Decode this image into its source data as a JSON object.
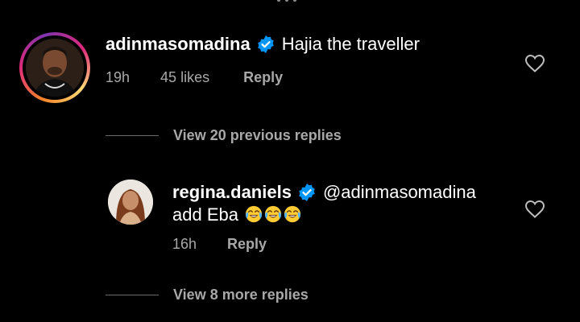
{
  "comments": [
    {
      "username": "adinmasomadina",
      "text": "Hajia the traveller",
      "time": "19h",
      "likes": "45 likes",
      "reply_label": "Reply",
      "verified": true,
      "has_story_ring": true
    }
  ],
  "view_previous": "View 20 previous replies",
  "reply": {
    "username": "regina.daniels",
    "mention": "@adinmasomadina",
    "text": "add Eba",
    "emoji_count": 3,
    "emoji_icon": "face-with-tears-of-joy-icon",
    "time": "16h",
    "reply_label": "Reply",
    "verified": true
  },
  "view_more": "View 8 more replies",
  "colors": {
    "background": "#000000",
    "secondary_text": "#a8a8a8",
    "verified_blue": "#0095f6"
  }
}
